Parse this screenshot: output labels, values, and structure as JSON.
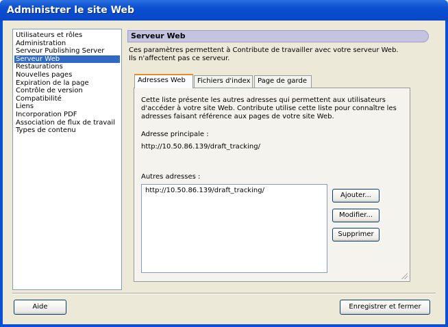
{
  "window": {
    "title": "Administrer le site Web"
  },
  "sidebar": {
    "selected": 3,
    "items": [
      "Utilisateurs et rôles",
      "Administration",
      "Serveur Publishing Server",
      "Serveur Web",
      "Restaurations",
      "Nouvelles pages",
      "Expiration de la page",
      "Contrôle de version",
      "Compatibilité",
      "Liens",
      "Incorporation PDF",
      "Association de flux de travail",
      "Types de contenu"
    ]
  },
  "main": {
    "title": "Serveur Web",
    "description_line1": "Ces paramètres permettent à Contribute de travailler avec votre serveur Web.",
    "description_line2": "Ils n'affectent pas ce serveur.",
    "tabs": [
      {
        "label": "Adresses Web"
      },
      {
        "label": "Fichiers d'index"
      },
      {
        "label": "Page de garde"
      }
    ],
    "panel": {
      "info_line1": "Cette liste présente les autres adresses qui permettent aux utilisateurs",
      "info_line2": "d'accéder à votre site Web. Contribute utilise cette liste pour connaître les",
      "info_line3": "adresses faisant référence aux pages de votre site Web.",
      "primary_label": "Adresse principale :",
      "primary_value": "http://10.50.86.139/draft_tracking/",
      "other_label": "Autres adresses :",
      "other_addresses": [
        "http://10.50.86.139/draft_tracking/"
      ],
      "add": "Ajouter...",
      "edit": "Modifier...",
      "delete": "Supprimer"
    }
  },
  "footer": {
    "help": "Aide",
    "save_close": "Enregistrer et fermer"
  }
}
